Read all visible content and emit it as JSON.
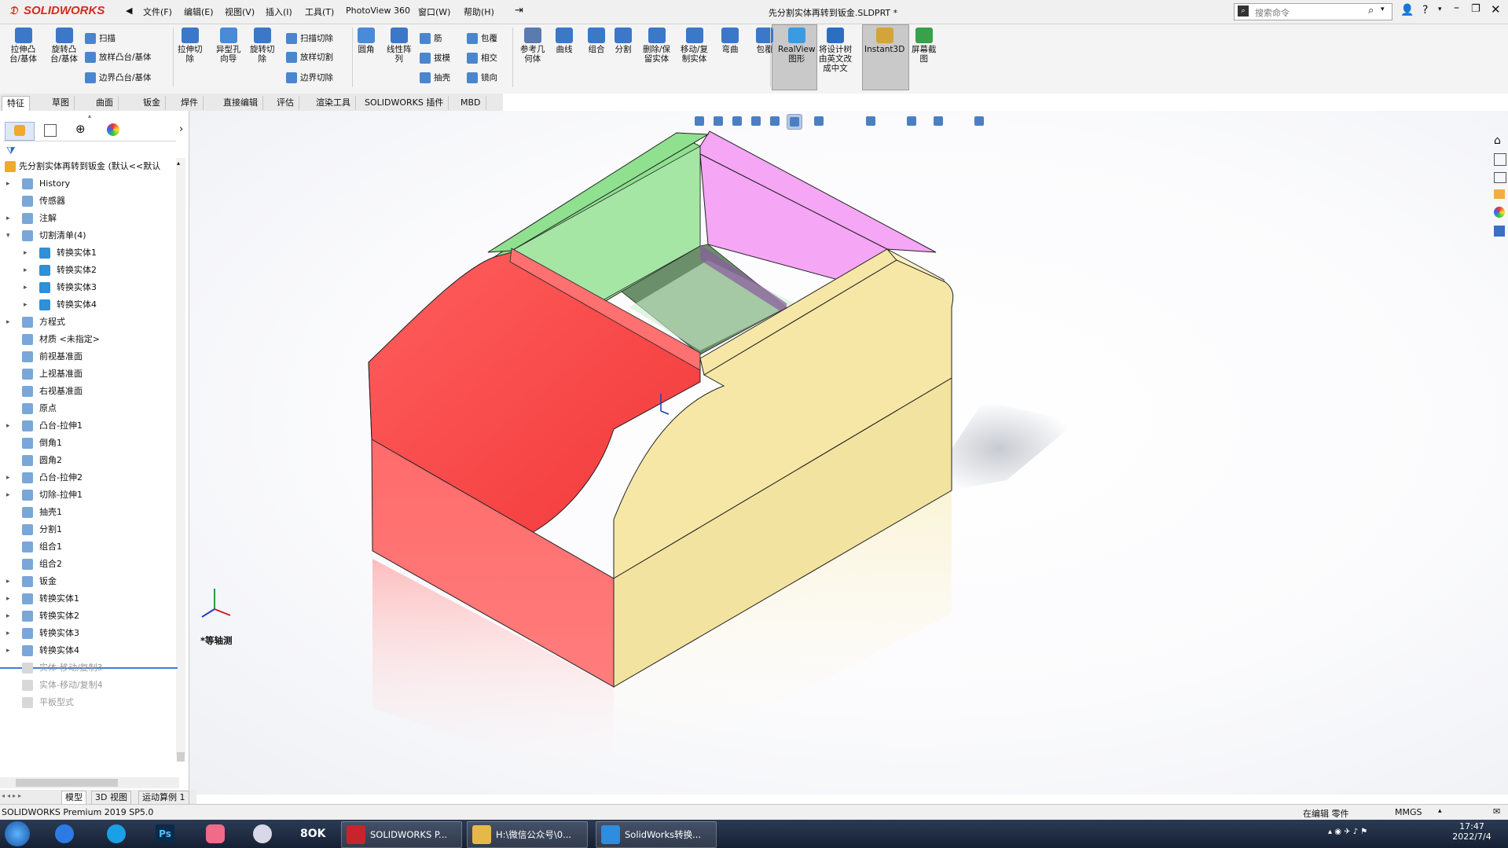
{
  "app": {
    "brand": "SOLIDWORKS",
    "document_title": "先分割实体再转到钣金.SLDPRT *",
    "menus": [
      "文件(F)",
      "编辑(E)",
      "视图(V)",
      "插入(I)",
      "工具(T)",
      "PhotoView 360",
      "窗口(W)",
      "帮助(H)"
    ],
    "search_placeholder": "搜索命令"
  },
  "commands": {
    "large": [
      {
        "label": "拉伸凸\n台/基体",
        "icon": "extruded-boss-icon"
      },
      {
        "label": "旋转凸\n台/基体",
        "icon": "revolved-boss-icon"
      },
      {
        "label": "拉伸切\n除",
        "icon": "extruded-cut-icon"
      },
      {
        "label": "异型孔\n向导",
        "icon": "hole-wizard-icon"
      },
      {
        "label": "旋转切\n除",
        "icon": "revolved-cut-icon"
      },
      {
        "label": "圆角",
        "icon": "fillet-icon"
      },
      {
        "label": "线性阵\n列",
        "icon": "linear-pattern-icon"
      },
      {
        "label": "参考几\n何体",
        "icon": "reference-geometry-icon"
      },
      {
        "label": "曲线",
        "icon": "curves-icon"
      },
      {
        "label": "组合",
        "icon": "combine-icon"
      },
      {
        "label": "分割",
        "icon": "split-icon"
      },
      {
        "label": "删除/保\n留实体",
        "icon": "delete-keep-body-icon"
      },
      {
        "label": "移动/复\n制实体",
        "icon": "move-copy-body-icon"
      },
      {
        "label": "弯曲",
        "icon": "flex-icon"
      },
      {
        "label": "包覆",
        "icon": "wrap-large-icon"
      },
      {
        "label": "RealView\n图形",
        "icon": "realview-icon"
      },
      {
        "label": "将设计树\n由英文改\n成中文",
        "icon": "translate-tree-icon"
      },
      {
        "label": "Instant3D",
        "icon": "instant3d-icon"
      },
      {
        "label": "屏幕截\n图",
        "icon": "screen-capture-icon"
      }
    ],
    "small": [
      {
        "label": "扫描",
        "icon": "swept-boss-icon"
      },
      {
        "label": "放样凸台/基体",
        "icon": "lofted-boss-icon"
      },
      {
        "label": "边界凸台/基体",
        "icon": "boundary-boss-icon"
      },
      {
        "label": "扫描切除",
        "icon": "swept-cut-icon"
      },
      {
        "label": "放样切割",
        "icon": "lofted-cut-icon"
      },
      {
        "label": "边界切除",
        "icon": "boundary-cut-icon"
      },
      {
        "label": "筋",
        "icon": "rib-icon"
      },
      {
        "label": "拔模",
        "icon": "draft-icon"
      },
      {
        "label": "抽壳",
        "icon": "shell-icon"
      },
      {
        "label": "包覆",
        "icon": "wrap-icon"
      },
      {
        "label": "相交",
        "icon": "intersect-icon"
      },
      {
        "label": "镜向",
        "icon": "mirror-icon"
      }
    ]
  },
  "tabs": [
    "特征",
    "草图",
    "曲面",
    "钣金",
    "焊件",
    "直接编辑",
    "评估",
    "渲染工具",
    "SOLIDWORKS 插件",
    "MBD"
  ],
  "tree": {
    "root": "先分割实体再转到钣金  (默认<<默认",
    "items": [
      {
        "label": "History",
        "level": 0,
        "expand": true,
        "state": "normal"
      },
      {
        "label": "传感器",
        "level": 0,
        "expand": false,
        "state": "normal"
      },
      {
        "label": "注解",
        "level": 0,
        "expand": true,
        "state": "normal"
      },
      {
        "label": "切割清单(4)",
        "level": 0,
        "expand": true,
        "state": "open"
      },
      {
        "label": "转换实体1",
        "level": 1,
        "expand": true,
        "state": "normal"
      },
      {
        "label": "转换实体2",
        "level": 1,
        "expand": true,
        "state": "normal"
      },
      {
        "label": "转换实体3",
        "level": 1,
        "expand": true,
        "state": "normal"
      },
      {
        "label": "转换实体4",
        "level": 1,
        "expand": true,
        "state": "normal"
      },
      {
        "label": "方程式",
        "level": 0,
        "expand": true,
        "state": "normal"
      },
      {
        "label": "材质 <未指定>",
        "level": 0,
        "expand": false,
        "state": "normal"
      },
      {
        "label": "前视基准面",
        "level": 0,
        "expand": false,
        "state": "normal"
      },
      {
        "label": "上视基准面",
        "level": 0,
        "expand": false,
        "state": "normal"
      },
      {
        "label": "右视基准面",
        "level": 0,
        "expand": false,
        "state": "normal"
      },
      {
        "label": "原点",
        "level": 0,
        "expand": false,
        "state": "normal"
      },
      {
        "label": "凸台-拉伸1",
        "level": 0,
        "expand": true,
        "state": "normal"
      },
      {
        "label": "倒角1",
        "level": 0,
        "expand": false,
        "state": "normal"
      },
      {
        "label": "圆角2",
        "level": 0,
        "expand": false,
        "state": "normal"
      },
      {
        "label": "凸台-拉伸2",
        "level": 0,
        "expand": true,
        "state": "normal"
      },
      {
        "label": "切除-拉伸1",
        "level": 0,
        "expand": true,
        "state": "normal"
      },
      {
        "label": "抽壳1",
        "level": 0,
        "expand": false,
        "state": "normal"
      },
      {
        "label": "分割1",
        "level": 0,
        "expand": false,
        "state": "normal"
      },
      {
        "label": "组合1",
        "level": 0,
        "expand": false,
        "state": "normal"
      },
      {
        "label": "组合2",
        "level": 0,
        "expand": false,
        "state": "normal"
      },
      {
        "label": "钣金",
        "level": 0,
        "expand": true,
        "state": "normal"
      },
      {
        "label": "转换实体1",
        "level": 0,
        "expand": true,
        "state": "normal"
      },
      {
        "label": "转换实体2",
        "level": 0,
        "expand": true,
        "state": "normal"
      },
      {
        "label": "转换实体3",
        "level": 0,
        "expand": true,
        "state": "normal"
      },
      {
        "label": "转换实体4",
        "level": 0,
        "expand": true,
        "state": "normal"
      },
      {
        "label": "实体-移动/复制3",
        "level": 0,
        "expand": false,
        "state": "suppressed"
      },
      {
        "label": "实体-移动/复制4",
        "level": 0,
        "expand": false,
        "state": "suppressed"
      },
      {
        "label": "平板型式",
        "level": 0,
        "expand": false,
        "state": "suppressed"
      }
    ]
  },
  "bottom_tabs": [
    "模型",
    "3D 视图",
    "运动算例 1"
  ],
  "view": {
    "orientation_label": "*等轴测"
  },
  "status": {
    "left": "SOLIDWORKS Premium 2019 SP5.0",
    "editing": "在编辑 零件",
    "units": "MMGS"
  },
  "taskbar": {
    "items": [
      {
        "label": "SOLIDWORKS P...",
        "icon": "solidworks-task-icon"
      },
      {
        "label": "H:\\微信公众号\\0...",
        "icon": "folder-task-icon"
      },
      {
        "label": "SolidWorks转换...",
        "icon": "browser-task-icon"
      }
    ],
    "time": "17:47",
    "date": "2022/7/4"
  },
  "colors": {
    "red_body": "#ff4d4d",
    "green_body": "#8fe08f",
    "magenta_body": "#f5a6f5",
    "yellow_body": "#f6e7a6"
  }
}
